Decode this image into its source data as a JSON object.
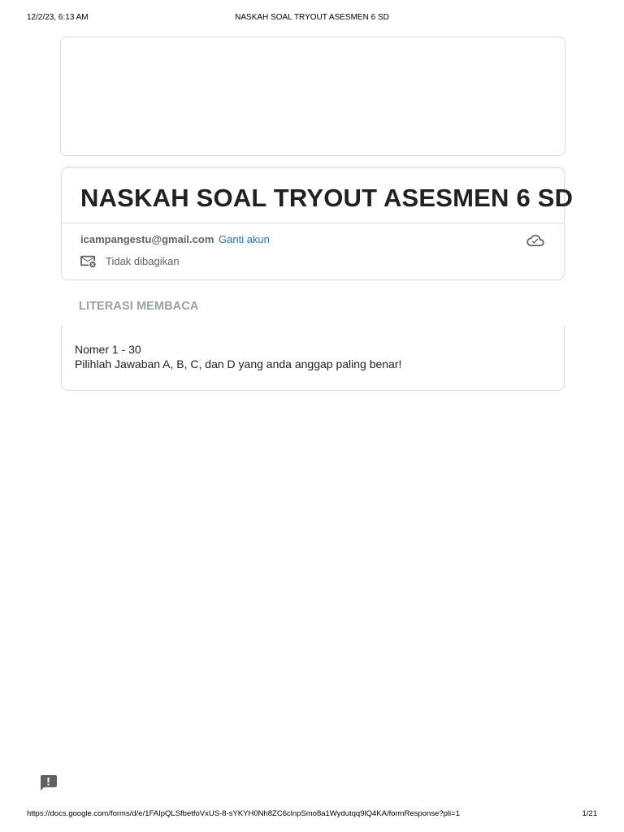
{
  "print_header": {
    "date": "12/2/23, 6:13 AM",
    "title": "NASKAH SOAL TRYOUT ASESMEN 6 SD"
  },
  "form": {
    "title": "NASKAH SOAL TRYOUT ASESMEN 6 SD",
    "account_email": "icampangestu@gmail.com",
    "switch_account_label": "Ganti akun",
    "share_status": "Tidak dibagikan"
  },
  "section": {
    "title": "LITERASI MEMBACA",
    "description_line1": "Nomer 1 - 30",
    "description_line2": "Pilihlah Jawaban A, B, C, dan D yang anda anggap paling benar!"
  },
  "print_footer": {
    "url": "https://docs.google.com/forms/d/e/1FAIpQLSfbetfoVxUS-8-sYKYH0Nh8ZC6clnpSmo8a1Wydutqq9lQ4KA/formResponse?pli=1",
    "page": "1/21"
  },
  "icons": {
    "cloud": "cloud-saved-icon",
    "mail": "mail-off-icon",
    "feedback": "feedback-icon"
  },
  "colors": {
    "link": "#1a73e8",
    "muted_text": "#5f6368",
    "section_title": "#9aa0a6",
    "border": "#dadce0"
  }
}
